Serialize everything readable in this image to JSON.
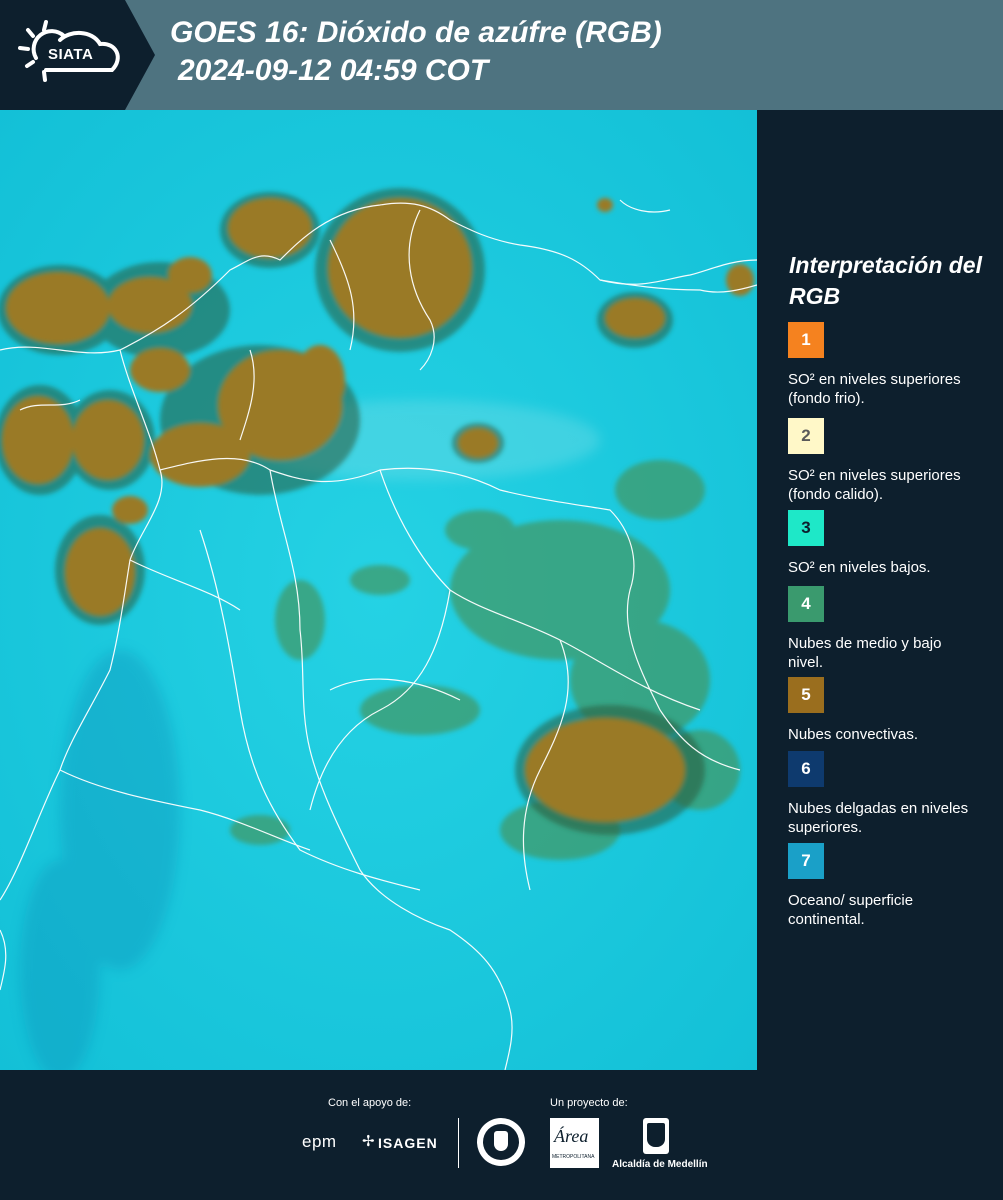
{
  "header": {
    "logo_text": "SIATA",
    "title_line1": "GOES 16: Dióxido de azúfre (RGB)",
    "title_line2": "2024-09-12 04:59 COT"
  },
  "legend": {
    "title": "Interpretación del RGB",
    "items": [
      {
        "number": "1",
        "label": "SO² en niveles superiores (fondo frio).",
        "color": "#f5821f",
        "text_color": "#ffffff"
      },
      {
        "number": "2",
        "label": "SO² en niveles superiores (fondo calido).",
        "color": "#fff8c8",
        "text_color": "#5a5a5a"
      },
      {
        "number": "3",
        "label": "SO² en niveles bajos.",
        "color": "#1ee8c8",
        "text_color": "#0d1f2d"
      },
      {
        "number": "4",
        "label": "Nubes de medio y bajo nivel.",
        "color": "#3a9a6e",
        "text_color": "#ffffff"
      },
      {
        "number": "5",
        "label": "Nubes convectivas.",
        "color": "#9a6e1e",
        "text_color": "#ffffff"
      },
      {
        "number": "6",
        "label": "Nubes delgadas en niveles superiores.",
        "color": "#0e3a6e",
        "text_color": "#ffffff"
      },
      {
        "number": "7",
        "label": "Oceano/ superficie continental.",
        "color": "#1aa0c8",
        "text_color": "#ffffff"
      }
    ]
  },
  "footer": {
    "support_caption": "Con el apoyo de:",
    "project_caption": "Un proyecto de:",
    "epm_logo": "epm",
    "isagen_logo": "ISAGEN",
    "area_logo": "Área",
    "area_sub": "METROPOLITANA",
    "alcaldia_label": "Alcaldía de Medellín"
  },
  "colors": {
    "ocean": "#18c9de",
    "convective": "#9a7a28",
    "low_clouds": "#3f9a6a",
    "header": "#4e7380",
    "background": "#0d1f2d"
  }
}
